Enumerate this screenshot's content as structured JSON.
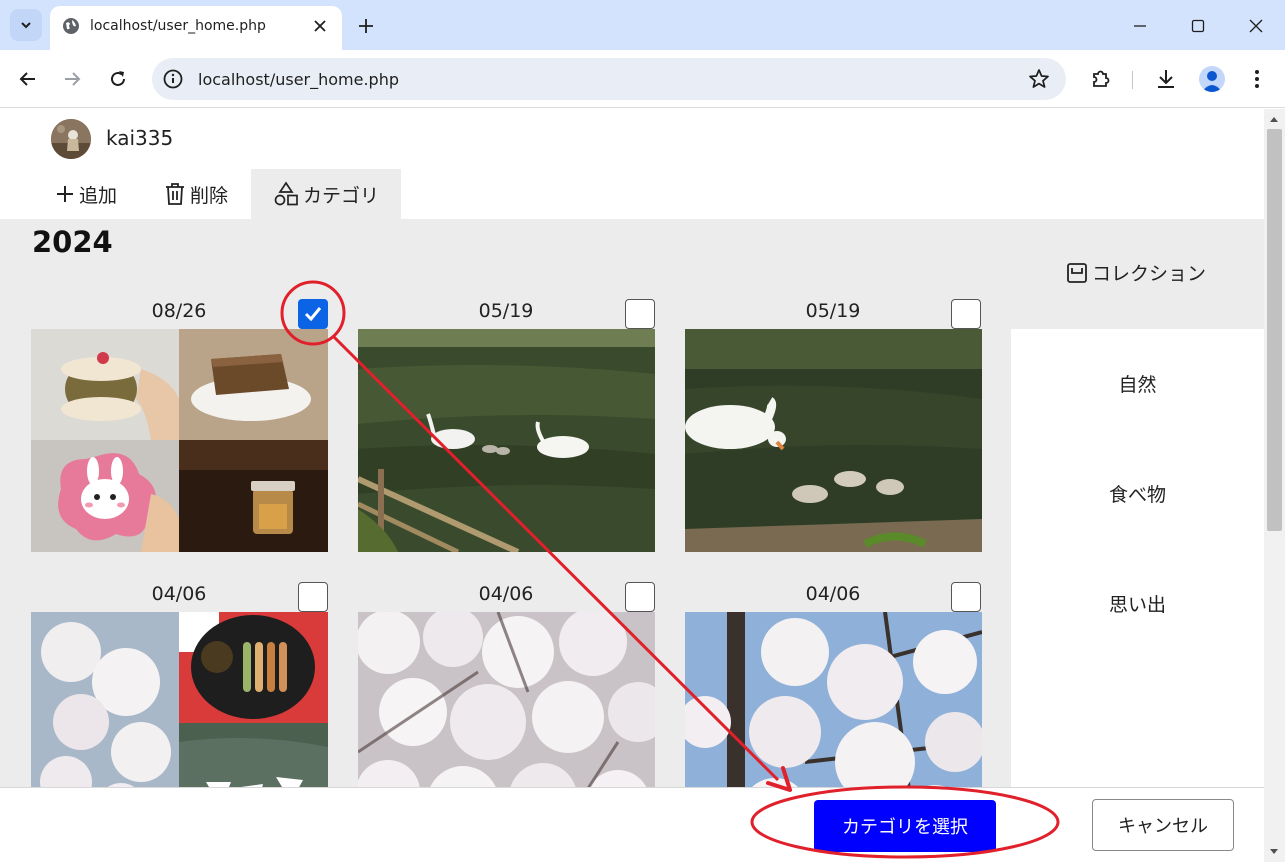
{
  "browser": {
    "tab_title": "localhost/user_home.php",
    "url": "localhost/user_home.php"
  },
  "user": {
    "name": "kai335"
  },
  "menu": {
    "add_label": "追加",
    "delete_label": "削除",
    "category_label": "カテゴリ"
  },
  "year": "2024",
  "collection_label": "コレクション",
  "categories": [
    "自然",
    "食べ物",
    "思い出"
  ],
  "cards": [
    {
      "date": "08/26",
      "checked": true,
      "photo": "food-collage"
    },
    {
      "date": "05/19",
      "checked": false,
      "photo": "swans-pond"
    },
    {
      "date": "05/19",
      "checked": false,
      "photo": "swan-cygnets"
    },
    {
      "date": "04/06",
      "checked": false,
      "photo": "sakura-dango-collage"
    },
    {
      "date": "04/06",
      "checked": false,
      "photo": "cherry-blossoms"
    },
    {
      "date": "04/06",
      "checked": false,
      "photo": "cherry-blossoms-branches"
    }
  ],
  "buttons": {
    "select_category": "カテゴリを選択",
    "cancel": "キャンセル"
  },
  "annotation_color": "#e0202a",
  "accent_color": "#0000ff"
}
